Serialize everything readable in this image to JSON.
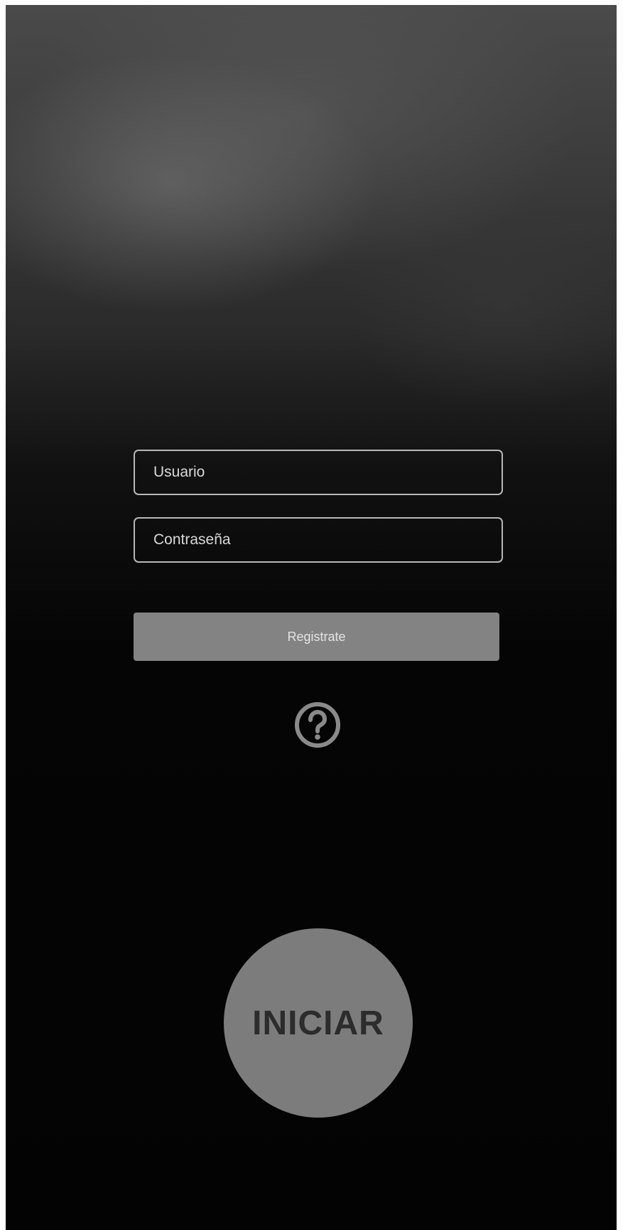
{
  "login": {
    "username": {
      "placeholder": "Usuario",
      "value": ""
    },
    "password": {
      "placeholder": "Contraseña",
      "value": ""
    },
    "register_label": "Registrate",
    "help_icon": "question-circle-icon",
    "start_label": "INICIAR"
  },
  "colors": {
    "field_border": "#b8b8b8",
    "field_text": "#d8d8d8",
    "register_bg": "#838383",
    "start_bg": "#7c7c7c",
    "start_text": "#2c2c2c",
    "help_icon": "#8a8a8a"
  }
}
